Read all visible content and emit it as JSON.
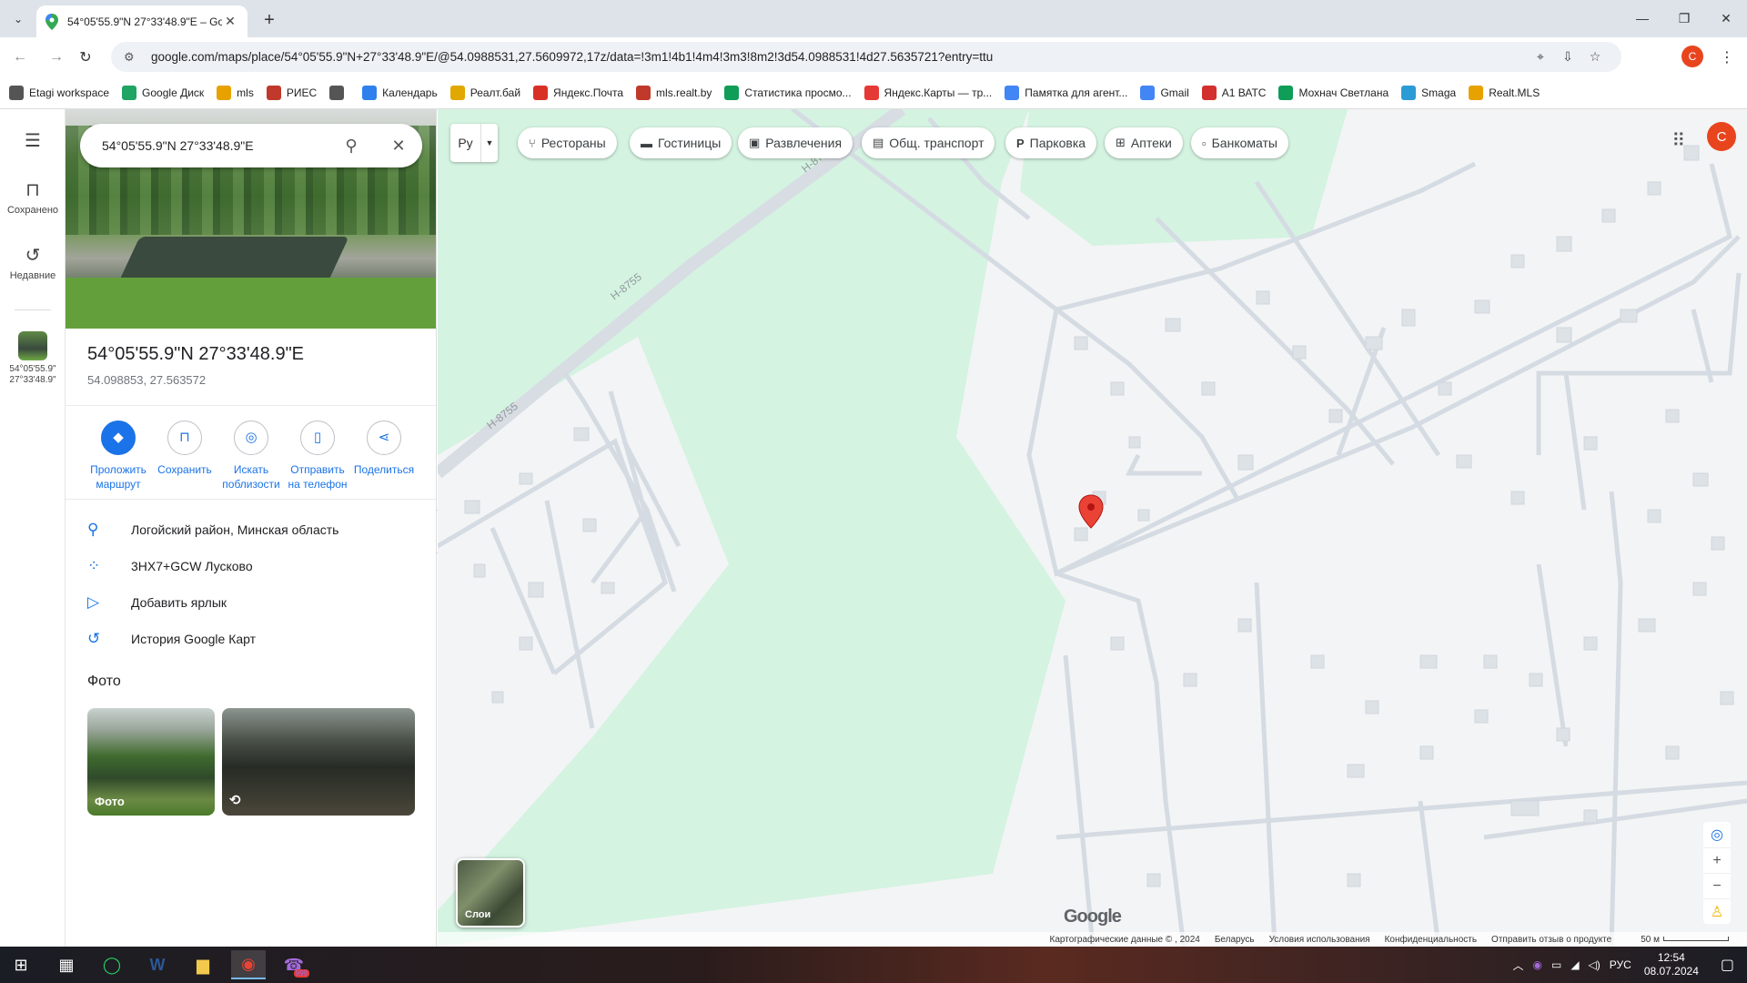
{
  "browser": {
    "tab_title": "54°05'55.9\"N 27°33'48.9\"E – Go",
    "url": "google.com/maps/place/54°05'55.9\"N+27°33'48.9\"E/@54.0988531,27.5609972,17z/data=!3m1!4b1!4m4!3m3!8m2!3d54.0988531!4d27.5635721?entry=ttu",
    "profile_initial": "C"
  },
  "bookmarks": [
    {
      "label": "Etagi workspace",
      "icon": "folder-icon",
      "color": "#555555"
    },
    {
      "label": "Google Диск",
      "icon": "drive-icon",
      "color": "#1fa463"
    },
    {
      "label": "mls",
      "icon": "mls-icon",
      "color": "#e8a200"
    },
    {
      "label": "РИЕС",
      "icon": "ries-icon",
      "color": "#c0392b"
    },
    {
      "label": "",
      "icon": "globe-icon",
      "color": "#555555"
    },
    {
      "label": "Календарь",
      "icon": "calendar-icon",
      "color": "#2f80ed"
    },
    {
      "label": "Реалт.бай",
      "icon": "realt-icon",
      "color": "#e0a800"
    },
    {
      "label": "Яндекс.Почта",
      "icon": "mail-icon",
      "color": "#d93025"
    },
    {
      "label": "mls.realt.by",
      "icon": "mls-icon",
      "color": "#c0392b"
    },
    {
      "label": "Статистика просмо...",
      "icon": "sheets-icon",
      "color": "#0f9d58"
    },
    {
      "label": "Яндекс.Карты — тр...",
      "icon": "pin-icon",
      "color": "#e53935"
    },
    {
      "label": "Памятка для агент...",
      "icon": "docs-icon",
      "color": "#4285f4"
    },
    {
      "label": "Gmail",
      "icon": "google-icon",
      "color": "#4285f4"
    },
    {
      "label": "A1 ВАТС",
      "icon": "a1-icon",
      "color": "#d32f2f"
    },
    {
      "label": "Мохнач Светлана",
      "icon": "sheets-icon",
      "color": "#0f9d58"
    },
    {
      "label": "Smaga",
      "icon": "smaga-icon",
      "color": "#2b9bd6"
    },
    {
      "label": "Realt.MLS",
      "icon": "mls-icon",
      "color": "#e8a200"
    }
  ],
  "rail": {
    "saved": "Сохранено",
    "recent": "Недавние",
    "history_thumb": "54°05'55.9\" 27°33'48.9\""
  },
  "search": {
    "query": "54°05'55.9\"N 27°33'48.9\"E"
  },
  "place": {
    "title": "54°05'55.9\"N 27°33'48.9\"E",
    "decimal": "54.098853, 27.563572"
  },
  "actions": [
    {
      "l1": "Проложить",
      "l2": "маршрут"
    },
    {
      "l1": "Сохранить",
      "l2": ""
    },
    {
      "l1": "Искать",
      "l2": "поблизости"
    },
    {
      "l1": "Отправить",
      "l2": "на телефон"
    },
    {
      "l1": "Поделиться",
      "l2": ""
    }
  ],
  "info": [
    "Логойский район, Минская область",
    "3HX7+GCW Лусково",
    "Добавить ярлык",
    "История Google Карт"
  ],
  "photos": {
    "heading": "Фото",
    "label": "Фото"
  },
  "map": {
    "lang": "Ру",
    "chips": [
      "Рестораны",
      "Гостиницы",
      "Развлечения",
      "Общ. транспорт",
      "Парковка",
      "Аптеки",
      "Банкоматы"
    ],
    "road_label_1": "Н-8755",
    "road_label_2": "Н-8755",
    "road_label_3": "Н-87",
    "layers": "Слои",
    "logo": "Google",
    "attribution": [
      "Картографические данные © , 2024",
      "Беларусь",
      "Условия использования",
      "Конфиденциальность",
      "Отправить отзыв о продукте",
      "50 м"
    ]
  },
  "taskbar": {
    "lang": "РУС",
    "time": "12:54",
    "date": "08.07.2024",
    "badge": "999"
  },
  "colors": {
    "accent": "#1a73e8",
    "pin": "#ea4335",
    "park": "#d4f3e1",
    "road": "#d5dbe2"
  }
}
